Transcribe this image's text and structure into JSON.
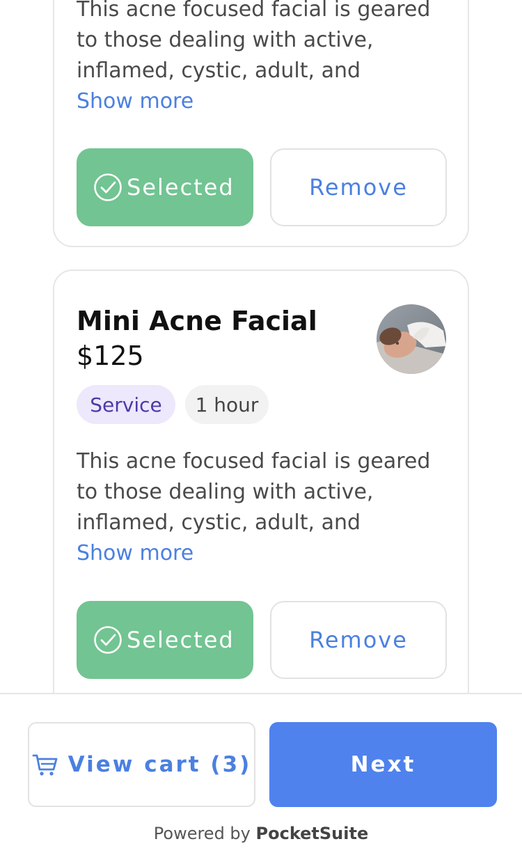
{
  "cards": [
    {
      "description_lines": [
        "This acne focused facial is geared",
        "to those dealing with active,",
        "inflamed, cystic, adult, and"
      ],
      "show_more": "Show more",
      "selected_label": "Selected",
      "remove_label": "Remove"
    },
    {
      "title": "Mini Acne Facial",
      "price": "$125",
      "tags": [
        "Service",
        "1 hour"
      ],
      "description_lines": [
        "This acne focused facial is geared",
        "to those dealing with active,",
        "inflamed, cystic, adult, and"
      ],
      "show_more": "Show more",
      "selected_label": "Selected",
      "remove_label": "Remove"
    }
  ],
  "footer": {
    "view_cart_label": "View cart (3)",
    "next_label": "Next",
    "powered_prefix": "Powered by",
    "powered_brand": "PocketSuite"
  },
  "colors": {
    "accent": "#4f82ed",
    "selected_green": "#72c492",
    "service_tag_bg": "#ede8fb",
    "service_tag_text": "#4b3aa8"
  },
  "icons": {
    "selected": "check-circle-icon",
    "cart": "shopping-cart-icon"
  }
}
